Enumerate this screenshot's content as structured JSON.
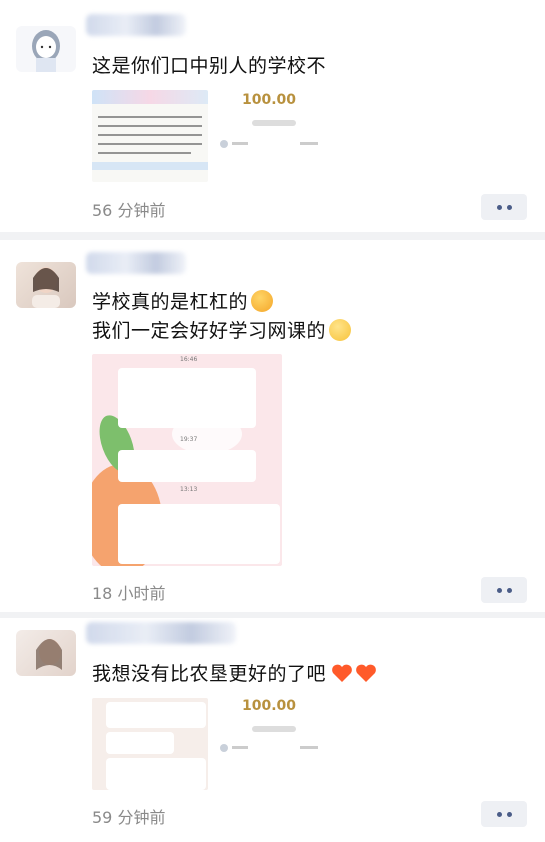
{
  "posts": [
    {
      "text_lines": [
        "这是你们口中别人的学校不"
      ],
      "time": "56 分钟前",
      "images": [
        {
          "type": "handwritten-notice"
        },
        {
          "type": "receipt",
          "amount": "100.00"
        }
      ]
    },
    {
      "text_lines": [
        "学校真的是杠杠的",
        "我们一定会好好学习网课的"
      ],
      "emojis": [
        "hugging-face-icon",
        "smile-icon"
      ],
      "time": "18 小时前",
      "images": [
        {
          "type": "chat-screenshot",
          "timestamps": [
            "16:46",
            "19:37",
            "13:13"
          ]
        }
      ]
    },
    {
      "text_lines": [
        "我想没有比农垦更好的了吧"
      ],
      "emojis": [
        "heart-icon",
        "heart-icon"
      ],
      "time": "59 分钟前",
      "images": [
        {
          "type": "chat-screenshot-small"
        },
        {
          "type": "receipt",
          "amount": "100.00"
        }
      ]
    }
  ],
  "colors": {
    "accent_blue": "#4b5d88",
    "time_grey": "#8a8a8a",
    "divider": "#f1f2f4",
    "heart": "#ff5a2a"
  }
}
